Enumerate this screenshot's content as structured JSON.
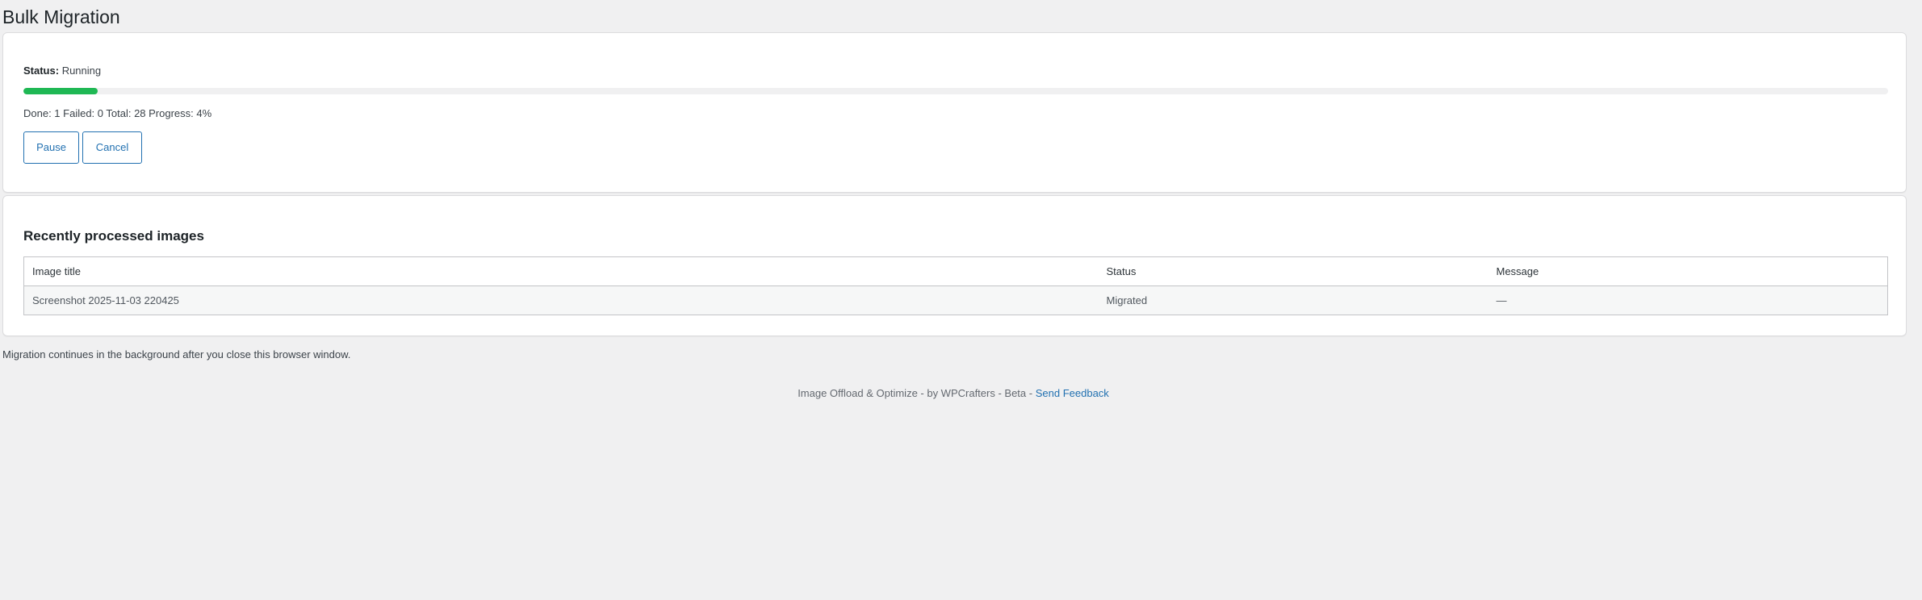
{
  "page": {
    "title": "Bulk Migration"
  },
  "status_card": {
    "status_label": "Status:",
    "status_value": "Running",
    "progress_percent": 4,
    "progress_color": "#1fb854",
    "counts_text": "Done: 1 Failed: 0 Total: 28 Progress: 4%",
    "pause_label": "Pause",
    "cancel_label": "Cancel"
  },
  "images_card": {
    "title": "Recently processed images",
    "columns": [
      "Image title",
      "Status",
      "Message"
    ],
    "rows": [
      {
        "title": "Screenshot 2025-11-03 220425",
        "status": "Migrated",
        "message": "—"
      }
    ]
  },
  "background_note": "Migration continues in the background after you close this browser window.",
  "footer": {
    "text": "Image Offload & Optimize - by WPCrafters - Beta -",
    "link": "Send Feedback"
  },
  "colors": {
    "accent": "#2271b1",
    "background": "#f0f0f1"
  }
}
